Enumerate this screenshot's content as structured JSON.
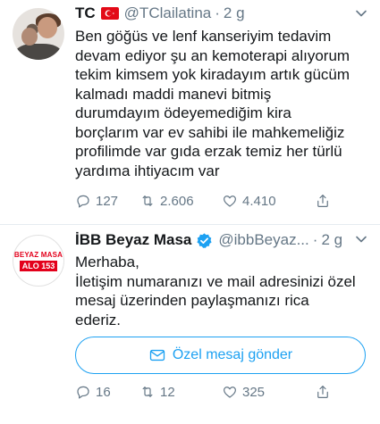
{
  "tweets": [
    {
      "name": "TC",
      "handle": "@TClailatina",
      "separator": "·",
      "time": "2 g",
      "text_lines": [
        "Ben göğüs ve lenf kanseriyim tedavim",
        "devam ediyor şu an kemoterapi alıyorum",
        "tekim kimsem yok kiradayım artık gücüm",
        "kalmadı maddi manevi bitmiş",
        "durumdayım ödeyemediğim kira",
        "borçlarım var ev sahibi ile mahkemeliğiz",
        "profilimde var gıda erzak temiz her türlü",
        "yardıma ihtiyacım var"
      ],
      "replies": "127",
      "retweets": "2.606",
      "likes": "4.410",
      "icons": {
        "flag": "turkey-flag-icon",
        "menu": "chevron-down-icon",
        "reply": "reply-icon",
        "retweet": "retweet-icon",
        "like": "heart-icon",
        "share": "share-icon"
      }
    },
    {
      "name": "İBB Beyaz Masa",
      "handle": "@ibbBeyaz...",
      "separator": "·",
      "time": "2 g",
      "avatar_text_top": "BEYAZ MASA",
      "avatar_text_bottom": "ALO 153",
      "text_lines": [
        "Merhaba,",
        "İletişim numaranızı ve mail adresinizi özel",
        "mesaj üzerinden paylaşmanızı rica",
        "ederiz."
      ],
      "dm_button_label": "Özel mesaj gönder",
      "replies": "16",
      "retweets": "12",
      "likes": "325",
      "icons": {
        "verified": "verified-badge-icon",
        "menu": "chevron-down-icon",
        "mail": "envelope-icon",
        "reply": "reply-icon",
        "retweet": "retweet-icon",
        "like": "heart-icon",
        "share": "share-icon"
      }
    }
  ],
  "colors": {
    "text": "#14171a",
    "secondary": "#657786",
    "accent": "#1da1f2",
    "flag_red": "#e30a17",
    "brand_red": "#e3001b",
    "divider": "#e6ecf0"
  }
}
